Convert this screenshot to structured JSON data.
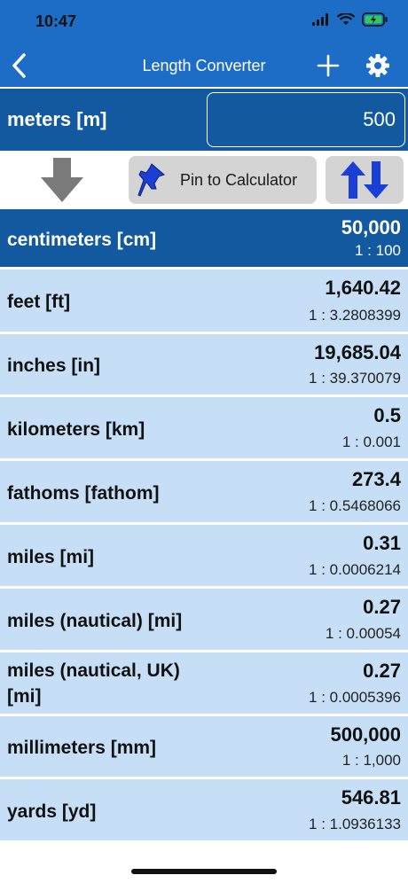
{
  "status": {
    "time": "10:47"
  },
  "nav": {
    "title": "Length Converter",
    "back_icon": "chevron-left-icon",
    "add_icon": "plus-icon",
    "settings_icon": "gear-icon"
  },
  "input": {
    "unit": "meters [m]",
    "value": "500"
  },
  "toolbar": {
    "pin_label": "Pin to Calculator",
    "pin_icon": "pushpin-icon",
    "swap_icon": "swap-arrows-icon",
    "convert_icon": "down-arrow-icon"
  },
  "colors": {
    "header": "#1d6dc7",
    "selected": "#13599f",
    "row": "#c6dff7",
    "pin_blue": "#1a3fd6"
  },
  "rows": [
    {
      "name": "centimeters [cm]",
      "value": "50,000",
      "ratio": "1 : 100",
      "selected": true
    },
    {
      "name": "feet [ft]",
      "value": "1,640.42",
      "ratio": "1 : 3.2808399"
    },
    {
      "name": "inches [in]",
      "value": "19,685.04",
      "ratio": "1 : 39.370079"
    },
    {
      "name": "kilometers [km]",
      "value": "0.5",
      "ratio": "1 : 0.001"
    },
    {
      "name": "fathoms [fathom]",
      "value": "273.4",
      "ratio": "1 : 0.5468066"
    },
    {
      "name": "miles [mi]",
      "value": "0.31",
      "ratio": "1 : 0.0006214"
    },
    {
      "name": "miles (nautical) [mi]",
      "value": "0.27",
      "ratio": "1 : 0.00054"
    },
    {
      "name": "miles (nautical, UK)",
      "name2": "[mi]",
      "value": "0.27",
      "ratio": "1 : 0.0005396"
    },
    {
      "name": "millimeters [mm]",
      "value": "500,000",
      "ratio": "1 : 1,000"
    },
    {
      "name": "yards [yd]",
      "value": "546.81",
      "ratio": "1 : 1.0936133"
    }
  ]
}
